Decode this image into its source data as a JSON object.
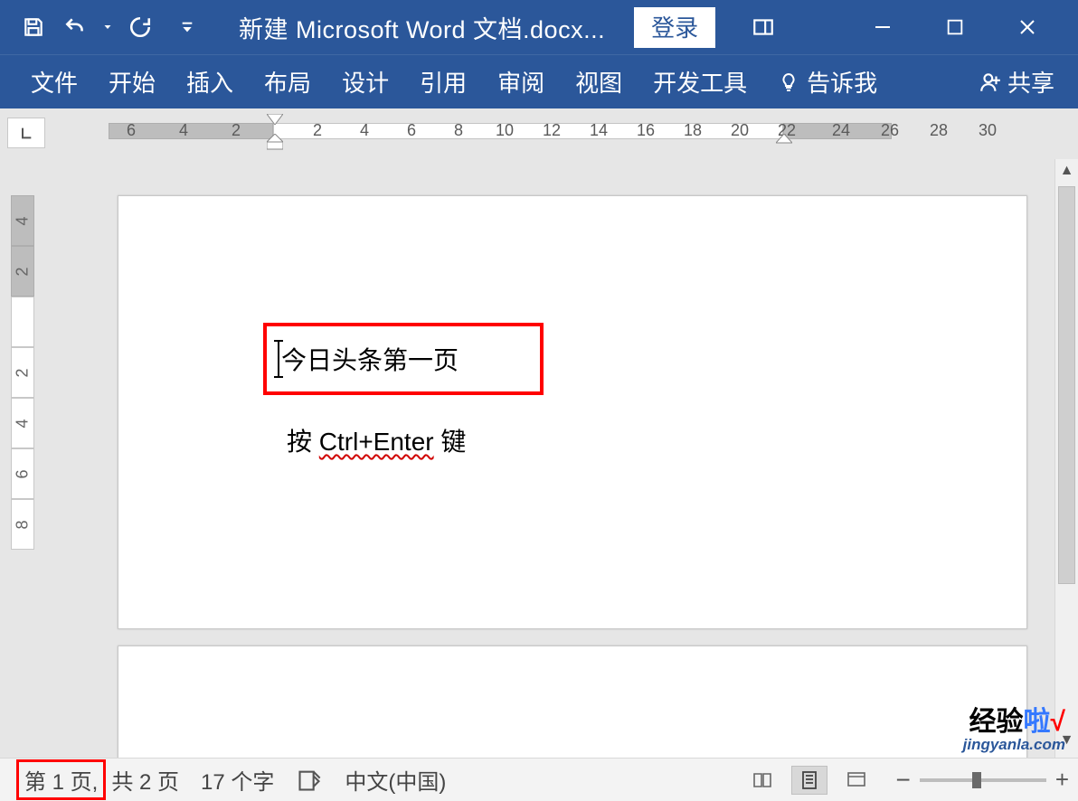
{
  "titlebar": {
    "doc_title": "新建 Microsoft Word 文档.docx...",
    "login": "登录"
  },
  "ribbon": {
    "tabs": [
      "文件",
      "开始",
      "插入",
      "布局",
      "设计",
      "引用",
      "审阅",
      "视图",
      "开发工具"
    ],
    "tell_me": "告诉我",
    "share": "共享"
  },
  "ruler": {
    "h_left": [
      "6",
      "4",
      "2"
    ],
    "h_right": [
      "2",
      "4",
      "6",
      "8",
      "10",
      "12",
      "14",
      "16",
      "18",
      "20",
      "22",
      "24",
      "26",
      "28",
      "30"
    ],
    "v": [
      "4",
      "2",
      "",
      "2",
      "4",
      "6",
      "8"
    ]
  },
  "document": {
    "line1": "今日头条第一页",
    "line2_prefix": "按 ",
    "line2_spellerr": "Ctrl+Enter",
    "line2_suffix": " 键"
  },
  "status": {
    "page_current": "第 1 页,",
    "page_total": "共 2 页",
    "word_count": "17 个字",
    "language": "中文(中国)"
  },
  "watermark": {
    "brand_a": "经验",
    "brand_b": "啦",
    "brand_c": "√",
    "url": "jingyanla.com"
  }
}
